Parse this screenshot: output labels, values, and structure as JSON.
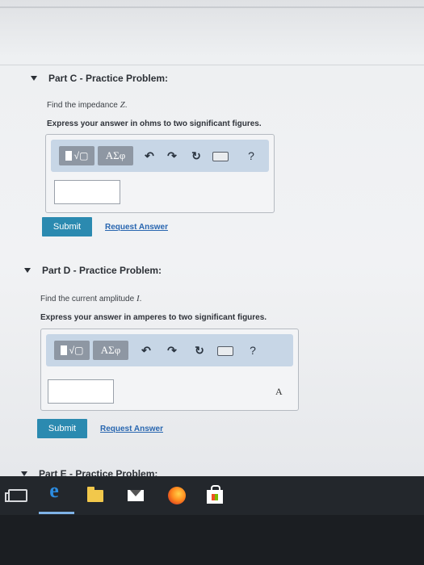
{
  "part_c": {
    "title": "Part C - Practice Problem:",
    "prompt_text": "Find the impedance",
    "prompt_var": "Z",
    "instruction": "Express your answer in ohms to two significant figures.",
    "input_value": "",
    "submit_label": "Submit",
    "request_label": "Request Answer"
  },
  "part_d": {
    "title": "Part D - Practice Problem:",
    "prompt_text": "Find the current amplitude",
    "prompt_var": "I",
    "instruction": "Express your answer in amperes to two significant figures.",
    "input_value": "",
    "unit": "A",
    "submit_label": "Submit",
    "request_label": "Request Answer"
  },
  "part_e": {
    "title": "Part E - Practice Problem:"
  },
  "toolbar": {
    "sqrt_label": "√▢",
    "greek_label": "ΑΣφ",
    "undo_icon": "undo-icon",
    "redo_icon": "redo-icon",
    "reset_icon": "reset-icon",
    "keyboard_icon": "keyboard-icon",
    "help_label": "?"
  },
  "taskbar": {
    "icons": [
      "task-view-icon",
      "internet-explorer-icon",
      "file-explorer-icon",
      "mail-icon",
      "firefox-icon",
      "store-icon"
    ]
  },
  "colors": {
    "submit": "#2b8ab0",
    "toolbar": "#c7d6e6",
    "link": "#2866b0",
    "taskbar": "#23272c"
  }
}
